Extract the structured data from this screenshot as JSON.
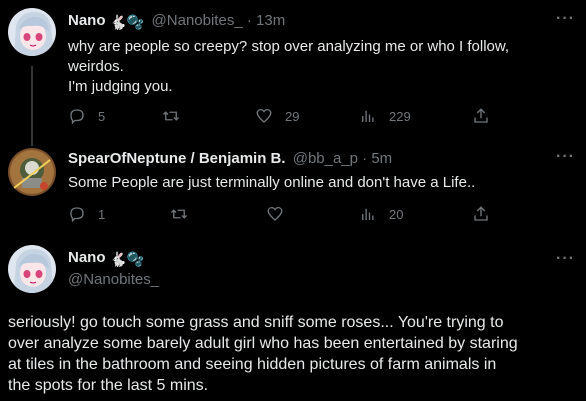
{
  "tweets": [
    {
      "name": "Nano",
      "emoji": "🐇🫧",
      "handle": "@Nanobites_",
      "separator": "·",
      "time": "13m",
      "lines": [
        "why are people so creepy? stop over analyzing me or who I follow,",
        "weirdos.",
        "I'm judging you."
      ],
      "replies": "5",
      "retweets": "",
      "likes": "29",
      "views": "229"
    },
    {
      "name": "SpearOfNeptune / Benjamin B.",
      "handle": "@bb_a_p",
      "separator": "·",
      "time": "5m",
      "lines": [
        "Some People are just terminally online and don't have a Life.."
      ],
      "replies": "1",
      "retweets": "",
      "likes": "",
      "views": "20"
    },
    {
      "name": "Nano",
      "emoji": "🐇🫧",
      "handle": "@Nanobites_",
      "lines": [
        "seriously! go touch some grass and sniff some roses... You're trying to",
        "over analyze some barely adult girl who has been entertained by staring",
        "at tiles in the bathroom and seeing hidden pictures of farm animals in",
        "the spots for the last 5 mins."
      ]
    }
  ],
  "icons": {
    "reply": "reply-icon",
    "retweet": "retweet-icon",
    "like": "heart-icon",
    "views": "views-icon",
    "share": "share-icon",
    "more": "more-icon"
  },
  "more_glyph": "···"
}
